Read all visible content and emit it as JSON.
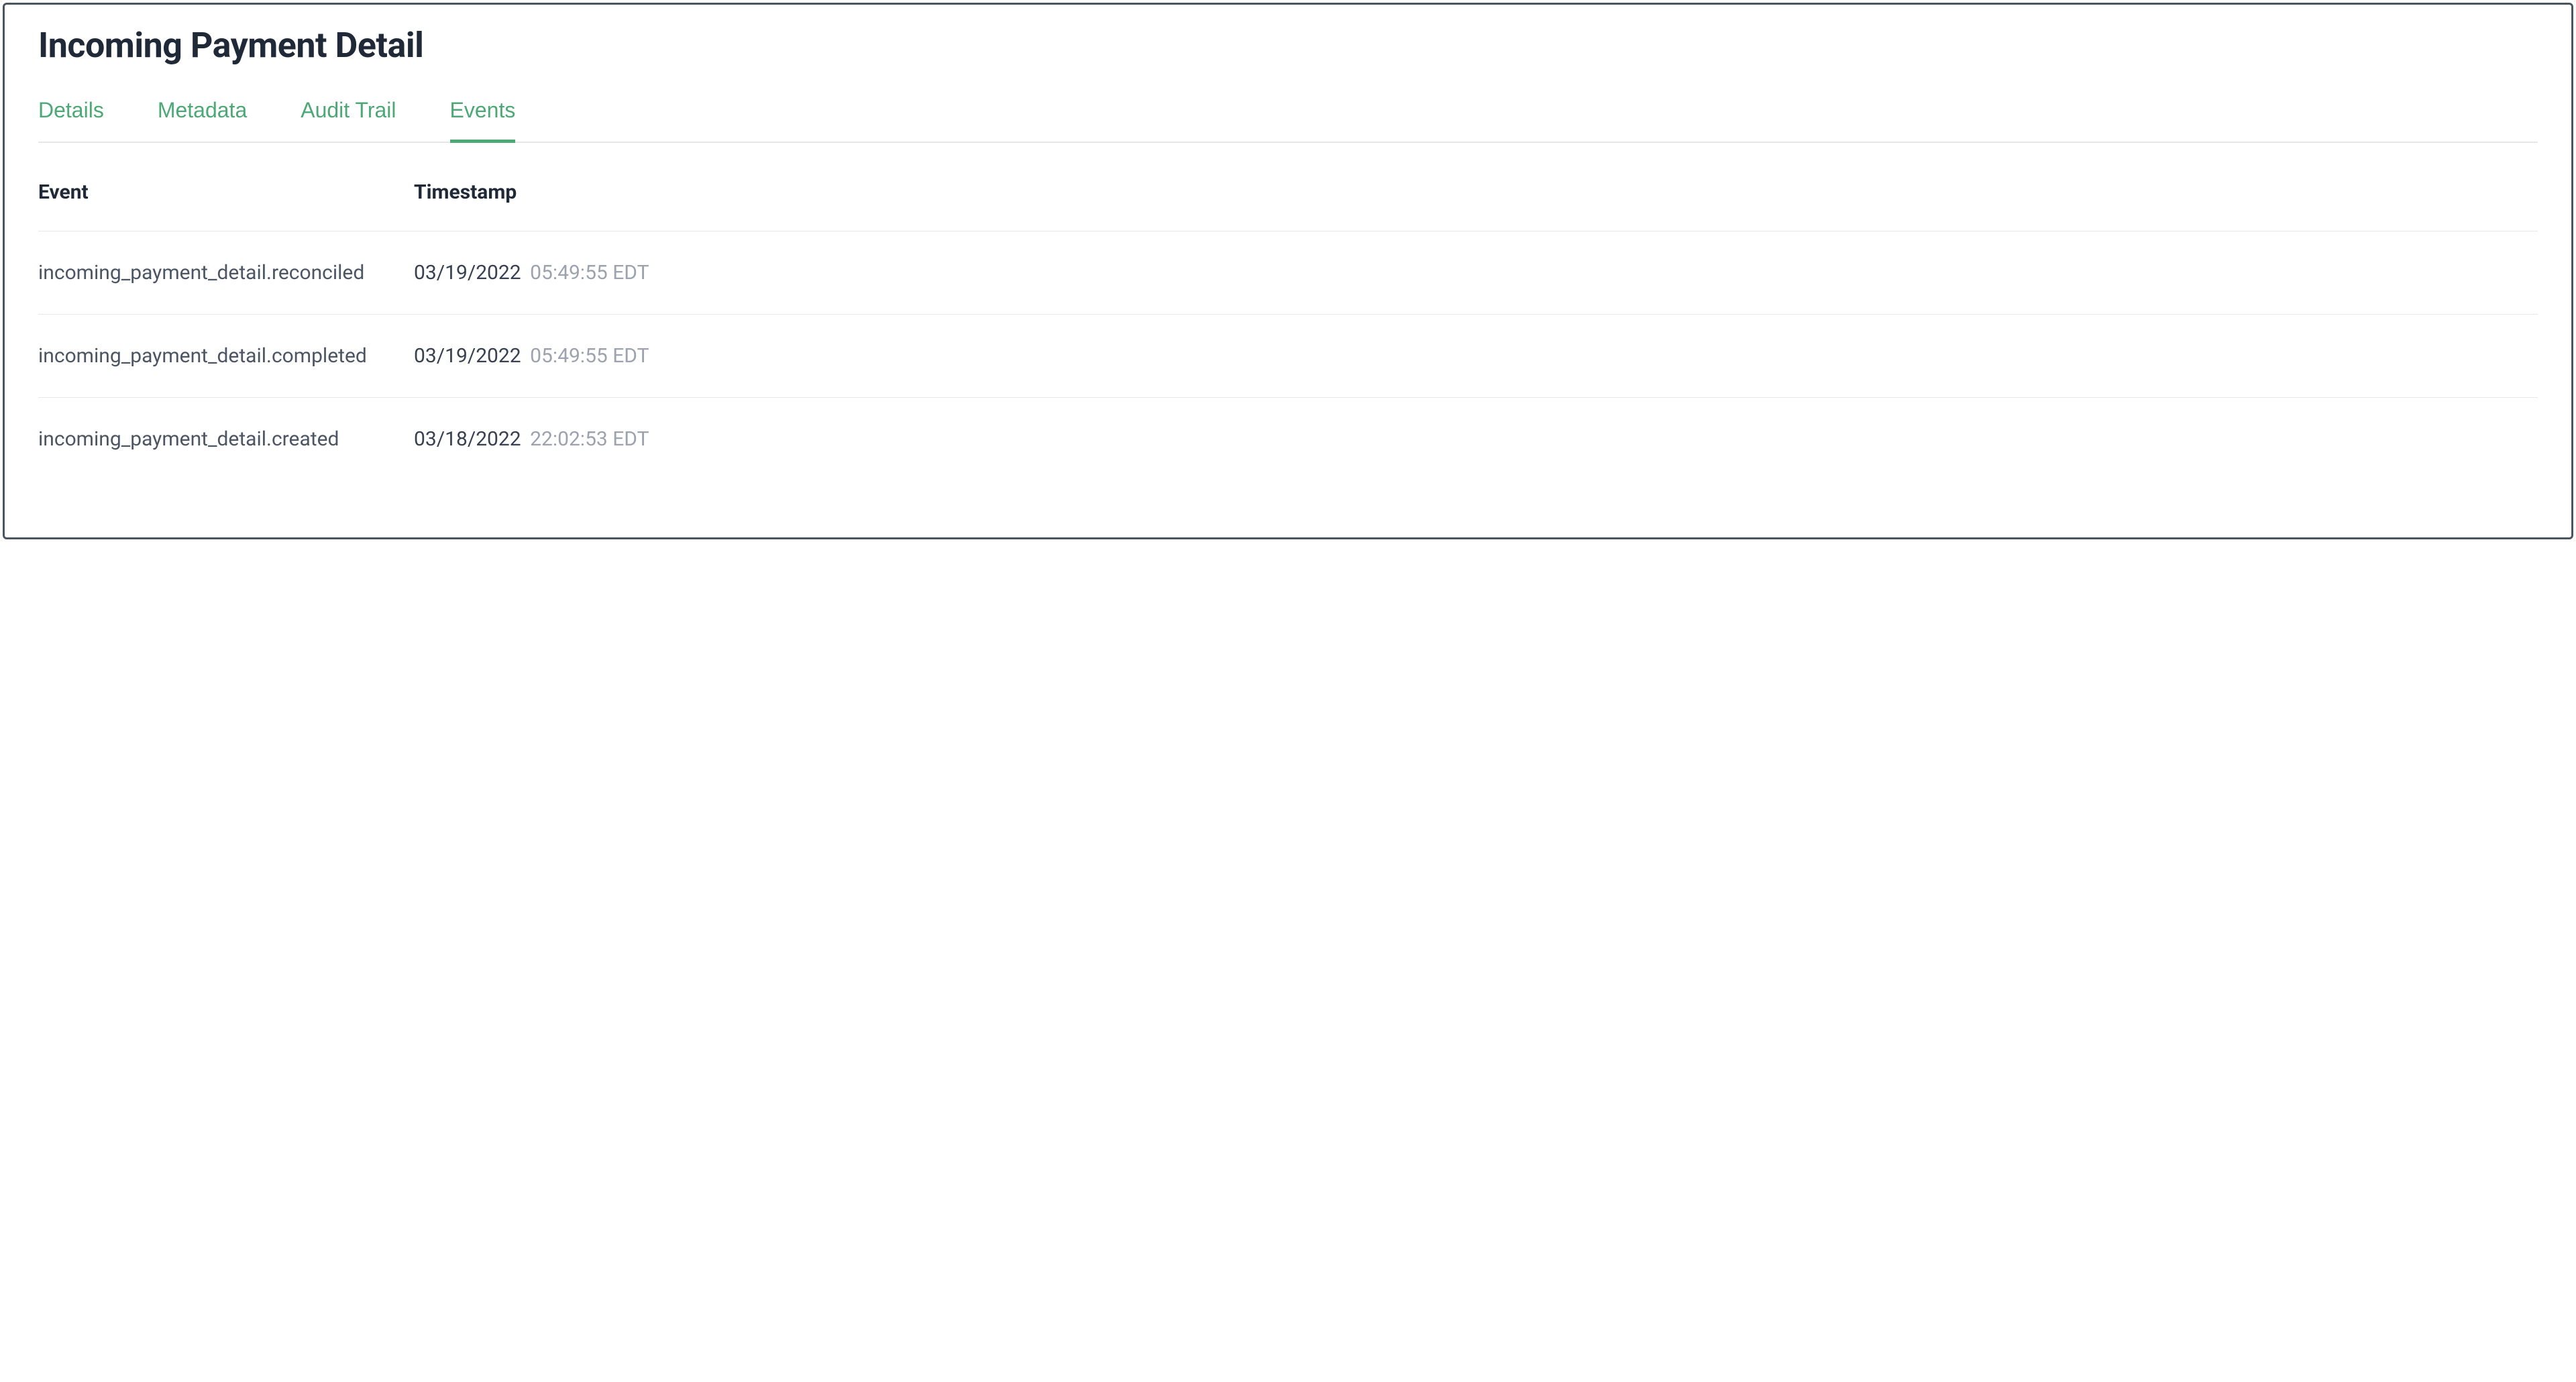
{
  "header": {
    "title": "Incoming Payment Detail"
  },
  "tabs": [
    {
      "label": "Details",
      "active": false
    },
    {
      "label": "Metadata",
      "active": false
    },
    {
      "label": "Audit Trail",
      "active": false
    },
    {
      "label": "Events",
      "active": true
    }
  ],
  "table": {
    "columns": {
      "event": "Event",
      "timestamp": "Timestamp"
    },
    "rows": [
      {
        "event": "incoming_payment_detail.reconciled",
        "date": "03/19/2022",
        "time": "05:49:55 EDT"
      },
      {
        "event": "incoming_payment_detail.completed",
        "date": "03/19/2022",
        "time": "05:49:55 EDT"
      },
      {
        "event": "incoming_payment_detail.created",
        "date": "03/18/2022",
        "time": "22:02:53 EDT"
      }
    ]
  },
  "colors": {
    "accent": "#4ca874",
    "text_primary": "#1f2937",
    "text_secondary": "#4b5563",
    "text_muted": "#9ca3af",
    "border": "#e5e7eb"
  }
}
